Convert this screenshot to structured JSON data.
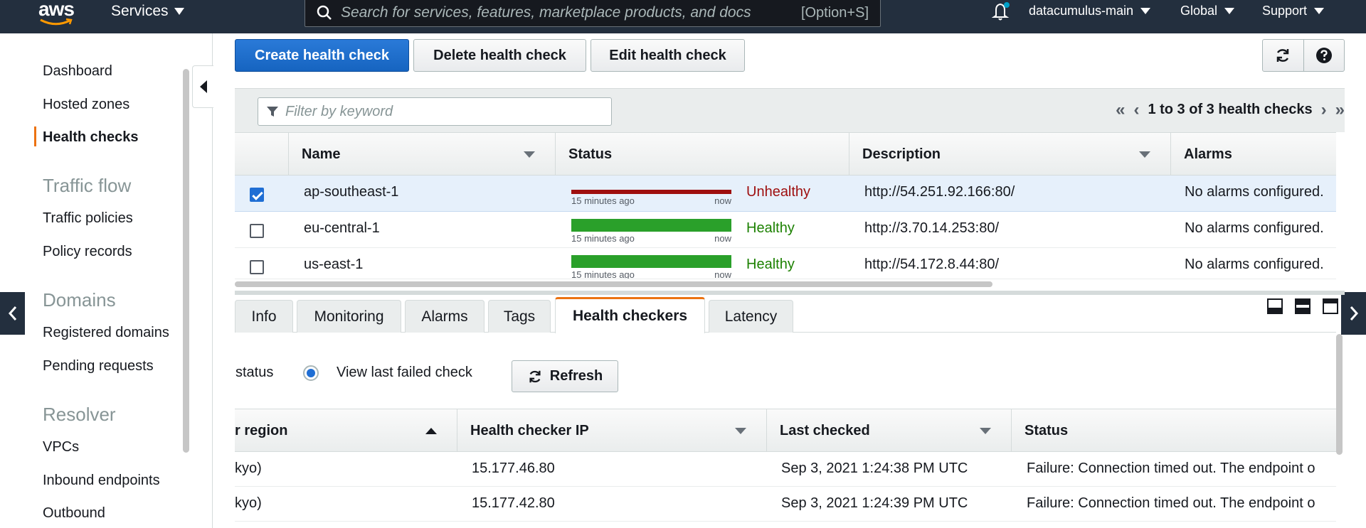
{
  "topnav": {
    "logo": "aws",
    "services": "Services",
    "search_placeholder": "Search for services, features, marketplace products, and docs",
    "search_shortcut": "[Option+S]",
    "account": "datacumulus-main",
    "region": "Global",
    "support": "Support"
  },
  "sidebar": {
    "items": [
      "Dashboard",
      "Hosted zones",
      "Health checks"
    ],
    "section_traffic": "Traffic flow",
    "traffic_items": [
      "Traffic policies",
      "Policy records"
    ],
    "section_domains": "Domains",
    "domain_items": [
      "Registered domains",
      "Pending requests"
    ],
    "section_resolver": "Resolver",
    "resolver_items": [
      "VPCs",
      "Inbound endpoints",
      "Outbound"
    ]
  },
  "toolbar": {
    "create": "Create health check",
    "delete": "Delete health check",
    "edit": "Edit health check"
  },
  "filter": {
    "placeholder": "Filter by keyword",
    "pager_text": "1 to 3 of 3 health checks"
  },
  "table": {
    "columns": [
      "Name",
      "Status",
      "Description",
      "Alarms"
    ],
    "rows": [
      {
        "name": "ap-southeast-1",
        "status": "Unhealthy",
        "bar_left": "15 minutes ago",
        "bar_right": "now",
        "description": "http://54.251.92.166:80/",
        "alarms": "No alarms configured."
      },
      {
        "name": "eu-central-1",
        "status": "Healthy",
        "bar_left": "15 minutes ago",
        "bar_right": "now",
        "description": "http://3.70.14.253:80/",
        "alarms": "No alarms configured."
      },
      {
        "name": "us-east-1",
        "status": "Healthy",
        "bar_left": "15 minutes ago",
        "bar_right": "now",
        "description": "http://54.172.8.44:80/",
        "alarms": "No alarms configured."
      }
    ]
  },
  "tabs": [
    "Info",
    "Monitoring",
    "Alarms",
    "Tags",
    "Health checkers",
    "Latency"
  ],
  "checkers": {
    "radio_left_label": "status",
    "radio_label": "View last failed check",
    "refresh": "Refresh",
    "columns": [
      "r region",
      "Health checker IP",
      "Last checked",
      "Status"
    ],
    "rows": [
      {
        "region": "kyo)",
        "ip": "15.177.46.80",
        "last": "Sep 3, 2021 1:24:38 PM UTC",
        "status": "Failure: Connection timed out. The endpoint o"
      },
      {
        "region": "kyo)",
        "ip": "15.177.42.80",
        "last": "Sep 3, 2021 1:24:39 PM UTC",
        "status": "Failure: Connection timed out. The endpoint o"
      }
    ]
  },
  "colors": {
    "nav_bg": "#232f3e",
    "accent": "#ec7211",
    "primary": "#1f6ed4",
    "unhealthy": "#9e0e0e",
    "healthy": "#2aa02a"
  }
}
